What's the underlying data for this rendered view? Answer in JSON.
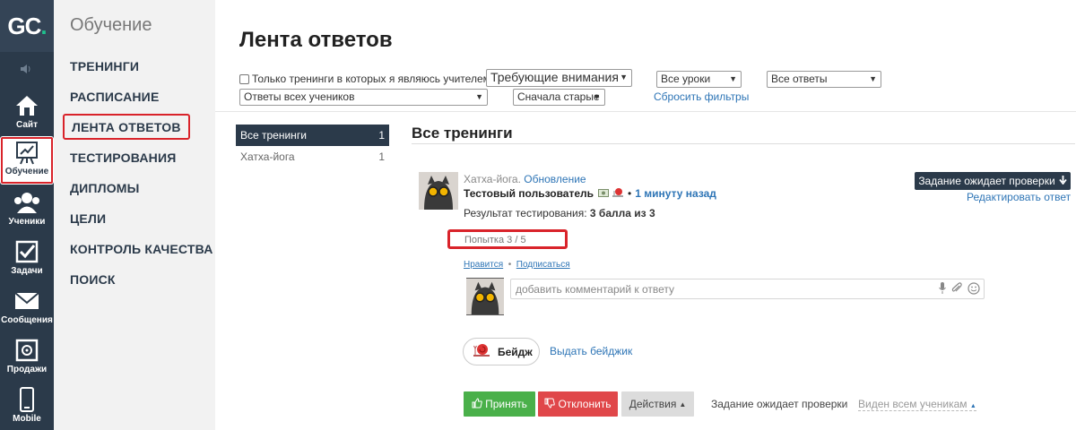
{
  "logo": {
    "text": "GC",
    "dot": "."
  },
  "rail": {
    "items": [
      {
        "label": "Сайт",
        "icon": "home-icon"
      },
      {
        "label": "Обучение",
        "icon": "presentation-chart-icon"
      },
      {
        "label": "Ученики",
        "icon": "users-icon"
      },
      {
        "label": "Задачи",
        "icon": "checkbox-icon"
      },
      {
        "label": "Сообщения",
        "icon": "envelope-icon"
      },
      {
        "label": "Продажи",
        "icon": "safe-icon"
      },
      {
        "label": "Mobile",
        "icon": "phone-icon"
      }
    ]
  },
  "subnav": {
    "title": "Обучение",
    "items": [
      "ТРЕНИНГИ",
      "РАСПИСАНИЕ",
      "ЛЕНТА ОТВЕТОВ",
      "ТЕСТИРОВАНИЯ",
      "ДИПЛОМЫ",
      "ЦЕЛИ",
      "КОНТРОЛЬ КАЧЕСТВА",
      "ПОИСК"
    ]
  },
  "page": {
    "title": "Лента ответов"
  },
  "filters": {
    "only_teacher_label": "Только тренинги в которых я являюсь учителем",
    "attention": "Требующие внимания",
    "lessons": "Все уроки",
    "answers": "Все ответы",
    "students": "Ответы всех учеников",
    "order": "Сначала старые",
    "reset": "Сбросить фильтры"
  },
  "trainings": [
    {
      "name": "Все тренинги",
      "count": "1"
    },
    {
      "name": "Хатха-йога",
      "count": "1"
    }
  ],
  "feed": {
    "title": "Все тренинги",
    "answer": {
      "course": "Хатха-йога.",
      "lesson": "Обновление",
      "user": "Тестовый пользователь",
      "bullet": "•",
      "time": "1 минуту назад",
      "result_label": "Результат тестирования:",
      "result_value": "3 балла из 3",
      "attempt": "Попытка 3 / 5",
      "status_button": "Задание ожидает проверки",
      "edit": "Редактировать ответ",
      "like": "Нравится",
      "subscribe": "Подписаться",
      "comment_placeholder": "добавить комментарий к ответу",
      "badge": "Бейдж",
      "give_badge": "Выдать бейджик",
      "accept": "Принять",
      "reject": "Отклонить",
      "actions": "Действия",
      "status_text": "Задание ожидает проверки",
      "visible_to": "Виден всем ученикам"
    }
  }
}
